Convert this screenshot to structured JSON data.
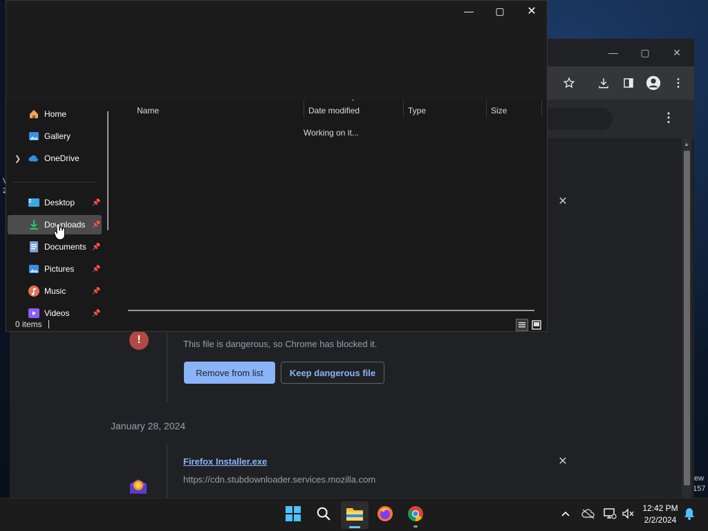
{
  "chrome": {
    "danger_message": "This file is dangerous, so Chrome has blocked it.",
    "remove_button": "Remove from list",
    "keep_button": "Keep dangerous file",
    "date_heading": "January 28, 2024",
    "file_name": "Firefox Installer.exe",
    "file_url": "https://cdn.stubdownloader.services.mozilla.com",
    "toolbar_icons": [
      "star-icon",
      "download-icon",
      "side-panel-icon",
      "profile-icon",
      "menu-icon"
    ]
  },
  "explorer": {
    "nav": [
      {
        "label": "Home",
        "icon": "home-icon",
        "pinned": false
      },
      {
        "label": "Gallery",
        "icon": "gallery-icon",
        "pinned": false
      },
      {
        "label": "OneDrive",
        "icon": "onedrive-icon",
        "pinned": false
      },
      {
        "label": "Desktop",
        "icon": "desktop-icon",
        "pinned": true
      },
      {
        "label": "Downloads",
        "icon": "downloads-icon",
        "pinned": true,
        "selected": true
      },
      {
        "label": "Documents",
        "icon": "documents-icon",
        "pinned": true
      },
      {
        "label": "Pictures",
        "icon": "pictures-icon",
        "pinned": true
      },
      {
        "label": "Music",
        "icon": "music-icon",
        "pinned": true
      },
      {
        "label": "Videos",
        "icon": "videos-icon",
        "pinned": true
      }
    ],
    "columns": [
      "Name",
      "Date modified",
      "Type",
      "Size"
    ],
    "loading_text": "Working on it...",
    "status": "0 items"
  },
  "side_peek": {
    "left_letters": [
      "V",
      "2"
    ],
    "right_text": [
      "ew",
      "157"
    ]
  },
  "taskbar": {
    "apps": [
      "start-icon",
      "search-icon",
      "file-explorer-icon",
      "firefox-icon",
      "chrome-icon"
    ],
    "time": "12:42 PM",
    "date": "2/2/2024"
  },
  "colors": {
    "accent": "#60cdff",
    "chrome_link": "#8ab4f8",
    "danger": "#b04a42"
  }
}
